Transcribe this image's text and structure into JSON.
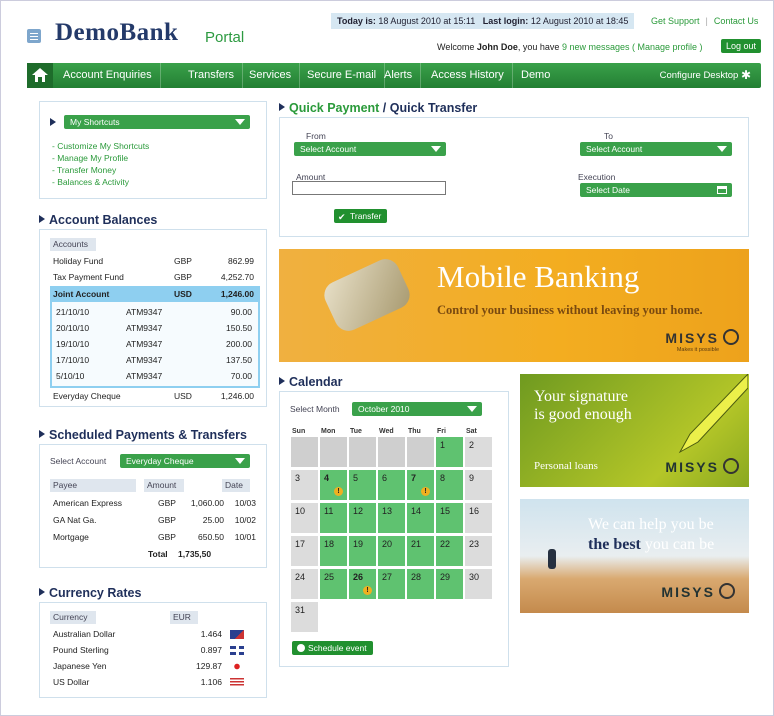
{
  "header": {
    "today_label": "Today is:",
    "today_value": "18 August 2010 at 15:11",
    "lastlogin_label": "Last login:",
    "lastlogin_value": "12 August 2010 at 18:45",
    "get_support": "Get Support",
    "contact_us": "Contact Us",
    "logo_main": "DemoBank",
    "logo_sub": "Portal",
    "welcome_prefix": "Welcome",
    "user_name": "John Doe",
    "welcome_mid": ", you have",
    "messages_link": "9 new messages",
    "manage_profile": "( Manage profile )",
    "logout": "Log out"
  },
  "nav": {
    "items": [
      "Account Enquiries",
      "Transfers",
      "Services",
      "Secure E-mail",
      "Alerts",
      "Access History",
      "Demo"
    ],
    "configure": "Configure Desktop"
  },
  "shortcuts": {
    "select": "My Shortcuts",
    "links": [
      "- Customize My Shortcuts",
      "- Manage My Profile",
      "- Transfer Money",
      "- Balances & Activity"
    ]
  },
  "balances": {
    "title": "Account Balances",
    "header": "Accounts",
    "rows": [
      {
        "name": "Holiday Fund",
        "cur": "GBP",
        "amt": "862.99"
      },
      {
        "name": "Tax Payment Fund",
        "cur": "GBP",
        "amt": "4,252.70"
      }
    ],
    "joint": {
      "name": "Joint Account",
      "cur": "USD",
      "amt": "1,246.00"
    },
    "tx": [
      {
        "date": "21/10/10",
        "ref": "ATM9347",
        "amt": "90.00"
      },
      {
        "date": "20/10/10",
        "ref": "ATM9347",
        "amt": "150.50"
      },
      {
        "date": "19/10/10",
        "ref": "ATM9347",
        "amt": "200.00"
      },
      {
        "date": "17/10/10",
        "ref": "ATM9347",
        "amt": "137.50"
      },
      {
        "date": "5/10/10",
        "ref": "ATM9347",
        "amt": "70.00"
      }
    ],
    "last": {
      "name": "Everyday Cheque",
      "cur": "USD",
      "amt": "1,246.00"
    }
  },
  "scheduled": {
    "title": "Scheduled Payments & Transfers",
    "select_label": "Select Account",
    "select_value": "Everyday Cheque",
    "headers": [
      "Payee",
      "Amount",
      "Date"
    ],
    "rows": [
      {
        "payee": "American Express",
        "cur": "GBP",
        "amt": "1,060.00",
        "date": "10/03"
      },
      {
        "payee": "GA Nat Ga.",
        "cur": "GBP",
        "amt": "25.00",
        "date": "10/02"
      },
      {
        "payee": "Mortgage",
        "cur": "GBP",
        "amt": "650.50",
        "date": "10/01"
      }
    ],
    "total_label": "Total",
    "total_value": "1,735,50"
  },
  "currency": {
    "title": "Currency Rates",
    "headers": [
      "Currency",
      "EUR"
    ],
    "rows": [
      {
        "name": "Australian Dollar",
        "rate": "1.464",
        "flag": "au-flag-icon"
      },
      {
        "name": "Pound Sterling",
        "rate": "0.897",
        "flag": "uk-flag-icon"
      },
      {
        "name": "Japanese Yen",
        "rate": "129.87",
        "flag": "jp-flag-icon"
      },
      {
        "name": "US Dollar",
        "rate": "1.106",
        "flag": "us-flag-icon"
      }
    ]
  },
  "quick": {
    "title_a": "Quick Payment",
    "title_sep": " / ",
    "title_b": "Quick Transfer",
    "from_label": "From",
    "from_select": "Select Account",
    "to_label": "To",
    "to_select": "Select Account",
    "amount_label": "Amount",
    "amount_value": "",
    "execution_label": "Execution",
    "execution_select": "Select Date",
    "transfer_btn": "Transfer"
  },
  "calendar": {
    "title": "Calendar",
    "select_label": "Select Month",
    "month": "October 2010",
    "days": [
      "Sun",
      "Mon",
      "Tue",
      "Wed",
      "Thu",
      "Fri",
      "Sat"
    ],
    "schedule_btn": "Schedule event"
  },
  "banners": {
    "mobile_title": "Mobile Banking",
    "mobile_sub": "Control your business without leaving your home.",
    "brand": "MISYS",
    "tagline": "Makes it possible",
    "sig_line1": "Your signature",
    "sig_line2": "is good enough",
    "sig_sub": "Personal loans",
    "best_line1": "We can help you be",
    "best_bold": "the best",
    "best_rest": "you can be"
  },
  "colors": {
    "accent": "#2e9a40",
    "navy": "#1f2f5a",
    "highlight": "#8ecff0"
  }
}
